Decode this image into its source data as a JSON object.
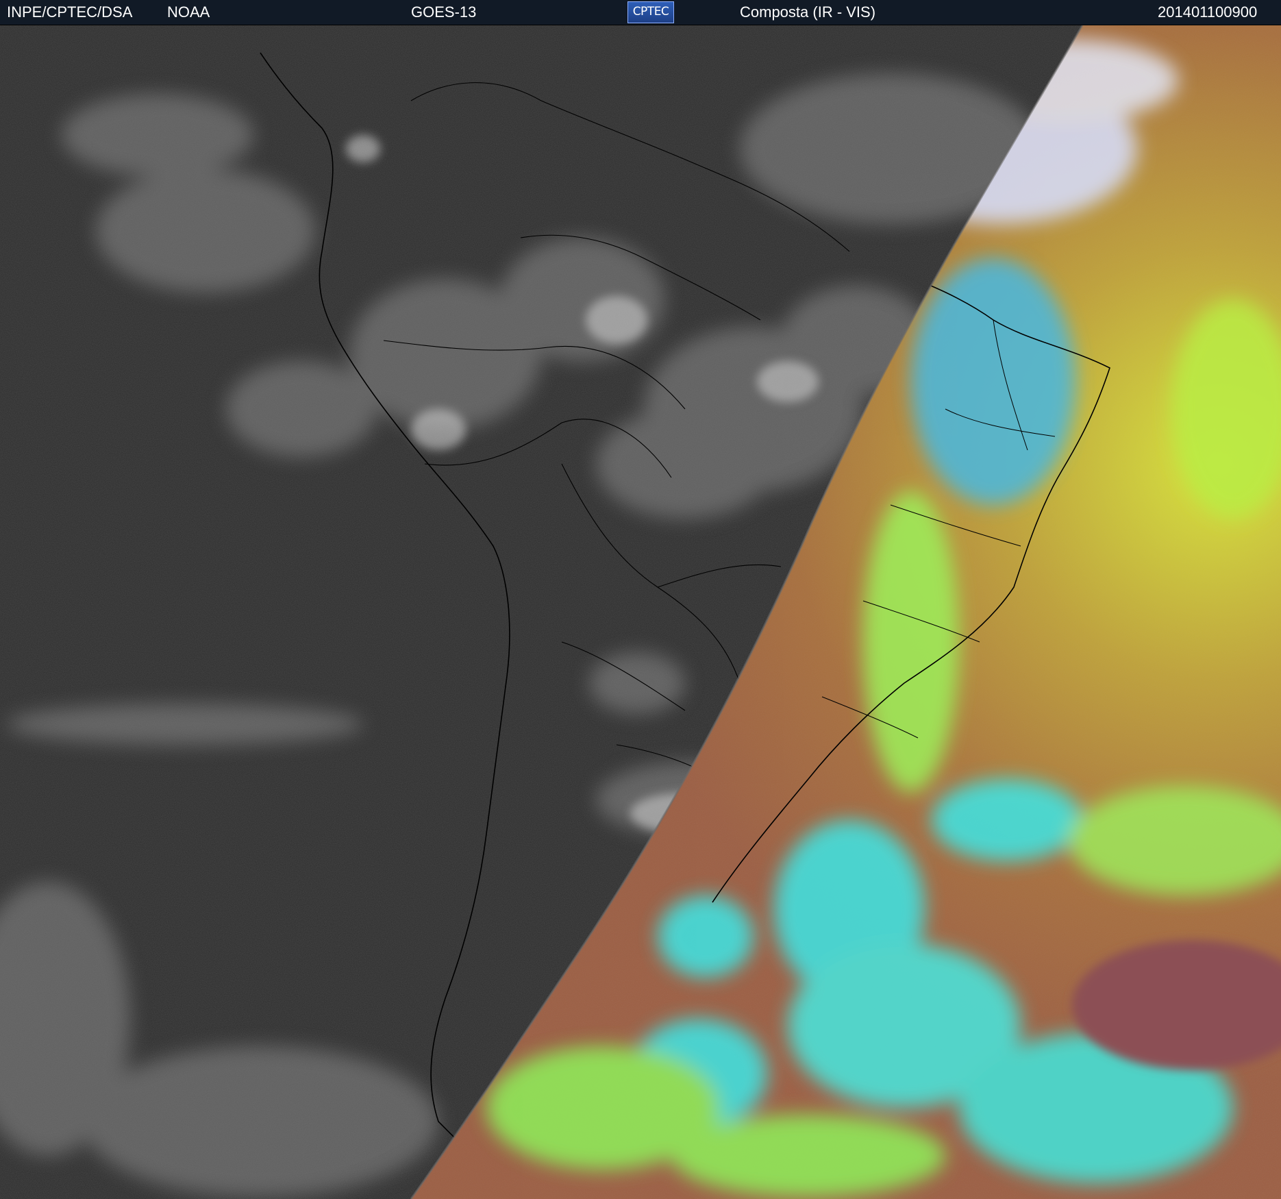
{
  "header": {
    "organization": "INPE/CPTEC/DSA",
    "agency": "NOAA",
    "satellite": "GOES-13",
    "logo_text": "CPTEC",
    "product": "Composta (IR - VIS)",
    "timestamp": "201401100900"
  },
  "colors": {
    "header_bg": "#111a26",
    "night_ir": "#2d2d2d",
    "day_land": "#a5604a",
    "day_ocean": "#b9a23c",
    "cloud_cyan": "#36ecec",
    "cloud_green": "#8cf05a",
    "borders": "#000000"
  }
}
